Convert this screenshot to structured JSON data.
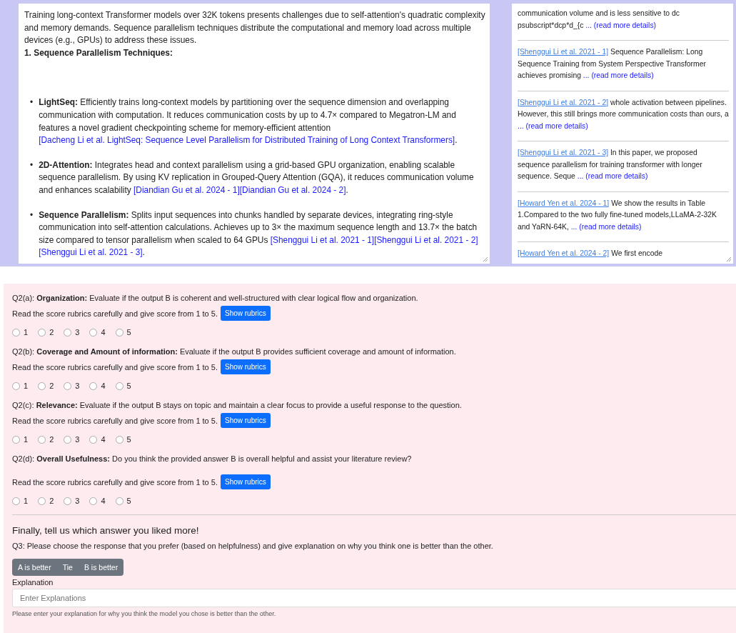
{
  "answer": {
    "intro": "Training long-context Transformer models over 32K tokens presents challenges due to self-attention's quadratic complexity and memory demands. Sequence parallelism techniques distribute the computational and memory load across multiple devices (e.g., GPUs) to address these issues.",
    "heading": "1. Sequence Parallelism Techniques:",
    "bullets": [
      {
        "marker": "•",
        "end": ".",
        "term": "LightSeq:",
        "text": "Efficiently trains long-context models by partitioning over the sequence dimension and overlapping communication with computation. It reduces communication costs by up to 4.7× compared to Megatron-LM and features a novel gradient checkpointing scheme for memory-efficient attention",
        "citations": [
          "[Dacheng Li et al. LightSeq: Sequence Level Parallelism for Distributed Training of Long Context Transformers]"
        ]
      },
      {
        "marker": "•",
        "end": ".",
        "term": "2D-Attention:",
        "text": "Integrates head and context parallelism using a grid-based GPU organization, enabling scalable sequence parallelism. By using KV replication in Grouped-Query Attention (GQA), it reduces communication volume and enhances scalability",
        "citations": [
          "[Diandian Gu et al. 2024 - 1]",
          "[Diandian Gu et al. 2024 - 2]"
        ]
      },
      {
        "marker": "•",
        "end": ".",
        "term": "Sequence Parallelism:",
        "text": "Splits input sequences into chunks handled by separate devices, integrating ring-style communication into self-attention calculations. Achieves up to 3× the maximum sequence length and 13.7× the batch size compared to tensor parallelism when scaled to 64 GPUs",
        "citations": [
          "[Shenggui Li et al. 2021 - 1]",
          "[Shenggui Li et al. 2021 - 2]",
          "[Shenggui Li et al. 2021 - 3]"
        ]
      }
    ]
  },
  "references": [
    {
      "text": "communication volume and is less sensitive to dc psubscript*dcp*d_{c",
      "more": "... (read more details)"
    },
    {
      "ref": "[Shenggui Li et al. 2021 - 1]",
      "text": "Sequence Parallelism: Long Sequence Training from System Perspective Transformer achieves promising",
      "more": "... (read more details)"
    },
    {
      "ref": "[Shenggui Li et al. 2021 - 2]",
      "text": "whole activation between pipelines. However, this still brings more communication costs than ours, a",
      "more": "... (read more details)"
    },
    {
      "ref": "[Shenggui Li et al. 2021 - 3]",
      "text": "In this paper, we proposed sequence parallelism for training transformer with longer sequence. Seque",
      "more": "... (read more details)"
    },
    {
      "ref": "[Howard Yen et al. 2024 - 1]",
      "text": "We show the results in Table 1.Compared to the two fully fine-tuned models,LLaMA-2-32K and YaRN-64K,",
      "more": "... (read more details)"
    },
    {
      "ref": "[Howard Yen et al. 2024 - 2]",
      "text": "We first encode"
    }
  ],
  "questions": [
    {
      "prompt": "Q2(a): **Organization:** Evaluate if the output B is coherent and well-structured with clear logical flow and organization.",
      "instruction": "Read the score rubrics carefully and give score from 1 to 5.",
      "button": "Show rubrics",
      "options": [
        {
          "label": "1",
          "selected": false
        },
        {
          "label": "2",
          "selected": false
        },
        {
          "label": "3",
          "selected": false
        },
        {
          "label": "4",
          "selected": false
        },
        {
          "label": "5",
          "selected": false
        }
      ]
    },
    {
      "prompt": "Q2(b): **Coverage and Amount of information:** Evaluate if the output B provides sufficient coverage and amount of information.",
      "instruction": "Read the score rubrics carefully and give score from 1 to 5.",
      "button": "Show rubrics",
      "options": [
        {
          "label": "1",
          "selected": false
        },
        {
          "label": "2",
          "selected": false
        },
        {
          "label": "3",
          "selected": false
        },
        {
          "label": "4",
          "selected": false
        },
        {
          "label": "5",
          "selected": false
        }
      ]
    },
    {
      "prompt": "Q2(c): **Relevance:** Evaluate if the output B stays on topic and maintain a clear focus to provide a useful response to the question.",
      "instruction": "Read the score rubrics carefully and give score from 1 to 5.",
      "button": "Show rubrics",
      "options": [
        {
          "label": "1",
          "selected": false
        },
        {
          "label": "2",
          "selected": false
        },
        {
          "label": "3",
          "selected": false
        },
        {
          "label": "4",
          "selected": false
        },
        {
          "label": "5",
          "selected": false
        }
      ]
    },
    {
      "prompt": "Q2(d): **Overall Usefulness:** Do you think the provided answer B is overall helpful and assist your literature review?",
      "instruction": "Read the score rubrics carefully and give score from 1 to 5.",
      "button": "Show rubrics",
      "options": [
        {
          "label": "1",
          "selected": false
        },
        {
          "label": "2",
          "selected": false
        },
        {
          "label": "3",
          "selected": false
        },
        {
          "label": "4",
          "selected": false
        },
        {
          "label": "5",
          "selected": false
        }
      ]
    }
  ],
  "final": {
    "title": "Finally, tell us which answer you liked more!",
    "question": "Q3: Please choose the response that you prefer (based on helpfulness) and give explanation on why you think one is better than the other.",
    "choices": [
      {
        "label": "A is better",
        "selected": false
      },
      {
        "label": "Tie",
        "selected": false
      },
      {
        "label": "B is better",
        "selected": false
      }
    ],
    "field_label": "Explanation",
    "placeholder": "Enter Explanations",
    "help": "Please enter your explanation for why you think the model you chose is better than the other."
  }
}
